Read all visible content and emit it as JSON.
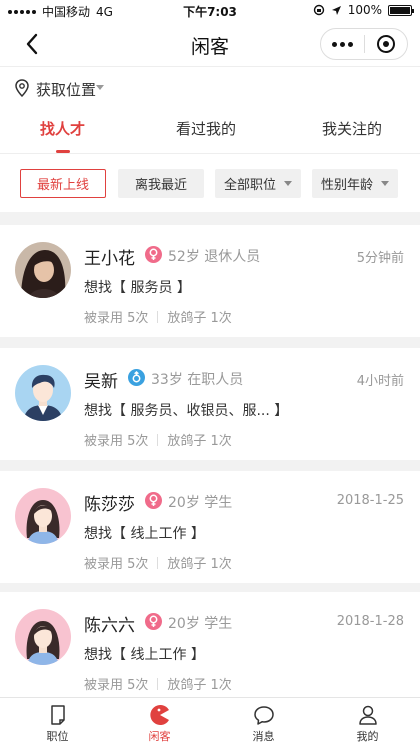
{
  "status": {
    "carrier": "中国移动",
    "network": "4G",
    "time": "下午7:03",
    "battery": "100%",
    "battery_level": 1.0
  },
  "nav": {
    "title": "闲客"
  },
  "location": {
    "label": "获取位置"
  },
  "tabs": [
    {
      "label": "找人才",
      "active": true
    },
    {
      "label": "看过我的",
      "active": false
    },
    {
      "label": "我关注的",
      "active": false
    }
  ],
  "filters": [
    {
      "label": "最新上线",
      "selected": true
    },
    {
      "label": "离我最近"
    },
    {
      "label": "全部职位"
    },
    {
      "label": "性别年龄"
    }
  ],
  "candidates": [
    {
      "name": "王小花",
      "gender": "female",
      "age": "52岁",
      "role": "退休人员",
      "time": "5分钟前",
      "want": "想找【 服务员 】",
      "hired": "被录用 5次",
      "flaked": "放鸽子 1次",
      "avatar": "photo-avatar"
    },
    {
      "name": "吴新",
      "gender": "male",
      "age": "33岁",
      "role": "在职人员",
      "time": "4小时前",
      "want": "想找【 服务员、收银员、服... 】",
      "hired": "被录用 5次",
      "flaked": "放鸽子 1次",
      "avatar": "male-avatar"
    },
    {
      "name": "陈莎莎",
      "gender": "female",
      "age": "20岁",
      "role": "学生",
      "time": "2018-1-25",
      "want": "想找【 线上工作 】",
      "hired": "被录用 5次",
      "flaked": "放鸽子 1次",
      "avatar": "female-avatar"
    },
    {
      "name": "陈六六",
      "gender": "female",
      "age": "20岁",
      "role": "学生",
      "time": "2018-1-28",
      "want": "想找【 线上工作 】",
      "hired": "被录用 5次",
      "flaked": "放鸽子 1次",
      "avatar": "female-avatar"
    }
  ],
  "tabbar": [
    {
      "label": "职位",
      "icon": "document-icon",
      "active": false
    },
    {
      "label": "闲客",
      "icon": "pacman-icon",
      "active": true
    },
    {
      "label": "消息",
      "icon": "chat-bubble-icon",
      "active": false
    },
    {
      "label": "我的",
      "icon": "person-icon",
      "active": false
    }
  ],
  "colors": {
    "accent": "#e0413f",
    "female": "#f06b8a",
    "male": "#3aa1e0"
  }
}
